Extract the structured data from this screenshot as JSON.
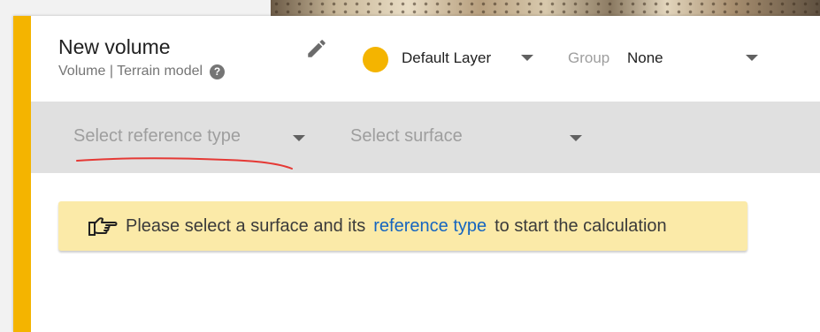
{
  "header": {
    "title": "New volume",
    "subtitle": "Volume | Terrain model",
    "help_icon": "?",
    "layer_label": "Default Layer",
    "group_label": "Group",
    "group_value": "None"
  },
  "toolbar": {
    "reference_placeholder": "Select reference type",
    "surface_placeholder": "Select surface"
  },
  "notice": {
    "text_before": "Please select a surface and its",
    "link_text": "reference type",
    "text_after": "to start the calculation"
  },
  "colors": {
    "accent": "#f4b400",
    "layer_dot": "#f4b400",
    "annotation_underline": "#e53935",
    "notice_background": "#fbeaa8",
    "link": "#1565c0"
  },
  "icons": {
    "edit": "pencil-icon",
    "help": "help-circle-icon",
    "notice": "pointing-hand-icon",
    "dropdown": "caret-down-icon"
  }
}
